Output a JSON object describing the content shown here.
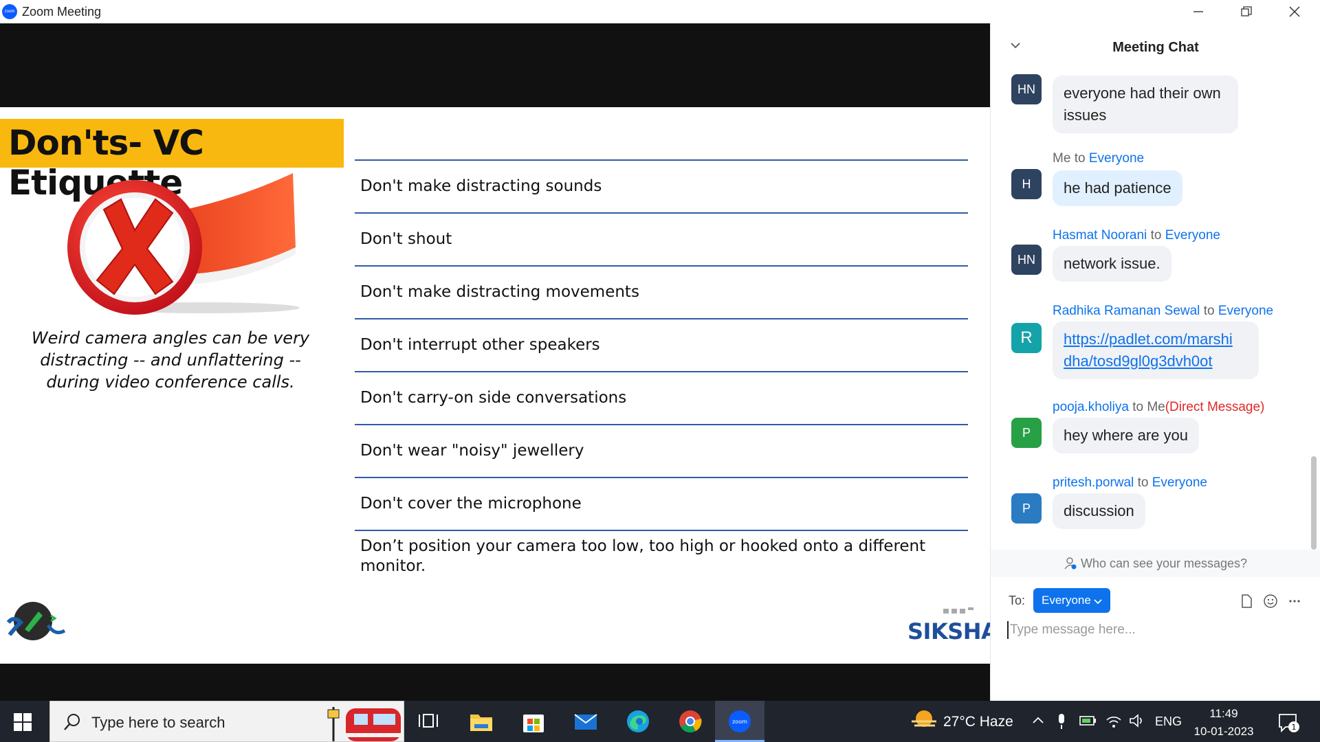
{
  "window": {
    "title": "Zoom Meeting"
  },
  "slide": {
    "title": "Don'ts- VC Etiquette",
    "caption": "Weird camera angles can be very distracting -- and unflattering -- during video conference calls.",
    "rules": [
      "Don't make distracting sounds",
      "Don't shout",
      "Don't make distracting movements",
      "Don't interrupt other speakers",
      "Don't carry-on side conversations",
      "Don't wear \"noisy\" jewellery",
      "Don't cover the microphone",
      "Don’t position your camera too low, too high or hooked onto a different monitor."
    ],
    "brand": "SIKSHA"
  },
  "chat": {
    "title": "Meeting Chat",
    "messages": [
      {
        "initials": "HN",
        "color": "#2e4360",
        "text": "everyone had their own issues",
        "sender": "",
        "recipient": "",
        "note": ""
      },
      {
        "initials": "H",
        "color": "#2e4360",
        "sender": "Me",
        "to_word": "to",
        "recipient": "Everyone",
        "text": "he had patience",
        "note": ""
      },
      {
        "initials": "HN",
        "color": "#2e4360",
        "sender": "Hasmat Noorani",
        "to_word": "to",
        "recipient": "Everyone",
        "text": "network issue.",
        "note": ""
      },
      {
        "initials": "R",
        "color": "#13a3a8",
        "sender": "Radhika Ramanan Sewal",
        "to_word": "to",
        "recipient": "Everyone",
        "text": "https://padlet.com/marshidha/tosd9gl0g3dvh0ot",
        "link_line1": "https://padlet.com/marshi",
        "link_line2": "dha/tosd9gl0g3dvh0ot",
        "note": ""
      },
      {
        "initials": "P",
        "color": "#27a046",
        "sender": "pooja.kholiya",
        "to_word": "to Me",
        "recipient": "",
        "note": "(Direct Message)",
        "text": "hey where are you"
      },
      {
        "initials": "P",
        "color": "#2a7bc2",
        "sender": "pritesh.porwal",
        "to_word": "to",
        "recipient": "Everyone",
        "text": "discussion",
        "note": ""
      }
    ],
    "who_can_see": "Who can see your messages?",
    "to_label": "To:",
    "to_value": "Everyone",
    "input_placeholder": "Type message here..."
  },
  "taskbar": {
    "search_placeholder": "Type here to search",
    "weather": "27°C  Haze",
    "language": "ENG",
    "time": "11:49",
    "date": "10-01-2023",
    "notifications": "1",
    "apps": [
      "task-view",
      "file-explorer",
      "microsoft-store",
      "mail",
      "edge",
      "chrome",
      "zoom"
    ]
  },
  "colors": {
    "accent": "#0e72ed",
    "slide_title_bg": "#f9b80f",
    "taskbar": "#20242c"
  }
}
